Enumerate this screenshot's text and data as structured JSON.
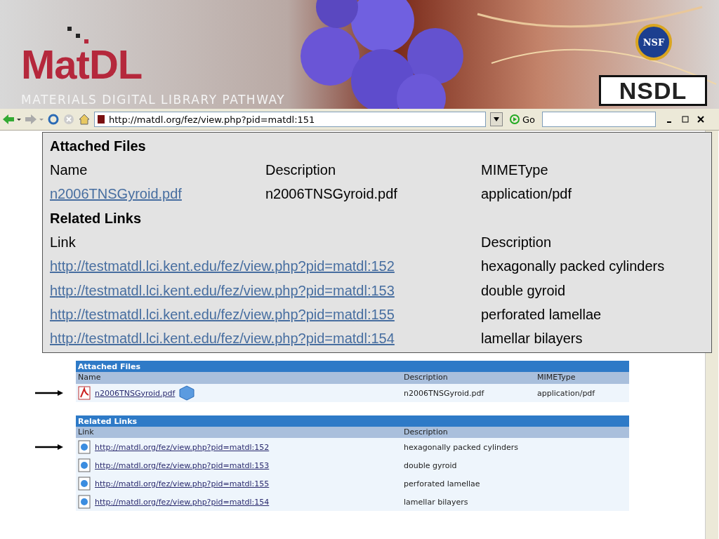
{
  "banner": {
    "logo": "MatDL",
    "tagline": "MATERIALS DIGITAL LIBRARY PATHWAY",
    "seal": "NSF",
    "brand": "NSDL"
  },
  "toolbar": {
    "url": "http://matdl.org/fez/view.php?pid=matdl:151",
    "go": "Go"
  },
  "popup": {
    "files_title": "Attached Files",
    "file_columns": [
      "Name",
      "Description",
      "MIMEType"
    ],
    "files": [
      {
        "name": "n2006TNSGyroid.pdf",
        "description": "n2006TNSGyroid.pdf",
        "mimetype": "application/pdf"
      }
    ],
    "links_title": "Related Links",
    "link_columns": [
      "Link",
      "Description"
    ],
    "links": [
      {
        "link": "http://testmatdl.lci.kent.edu/fez/view.php?pid=matdl:152",
        "description": "hexagonally packed cylinders"
      },
      {
        "link": "http://testmatdl.lci.kent.edu/fez/view.php?pid=matdl:153",
        "description": "double gyroid"
      },
      {
        "link": "http://testmatdl.lci.kent.edu/fez/view.php?pid=matdl:155",
        "description": "perforated lamellae"
      },
      {
        "link": "http://testmatdl.lci.kent.edu/fez/view.php?pid=matdl:154",
        "description": "lamellar bilayers"
      }
    ]
  },
  "page": {
    "files_title": "Attached Files",
    "file_columns": [
      "Name",
      "Description",
      "MIMEType"
    ],
    "files": [
      {
        "name": "n2006TNSGyroid.pdf",
        "description": "n2006TNSGyroid.pdf",
        "mimetype": "application/pdf",
        "arrow": true
      }
    ],
    "links_title": "Related Links",
    "link_columns": [
      "Link",
      "Description"
    ],
    "links": [
      {
        "link": "http://matdl.org/fez/view.php?pid=matdl:152",
        "description": "hexagonally packed cylinders",
        "arrow": true
      },
      {
        "link": "http://matdl.org/fez/view.php?pid=matdl:153",
        "description": "double gyroid",
        "arrow": false
      },
      {
        "link": "http://matdl.org/fez/view.php?pid=matdl:155",
        "description": "perforated lamellae",
        "arrow": false
      },
      {
        "link": "http://matdl.org/fez/view.php?pid=matdl:154",
        "description": "lamellar bilayers",
        "arrow": false
      }
    ]
  }
}
